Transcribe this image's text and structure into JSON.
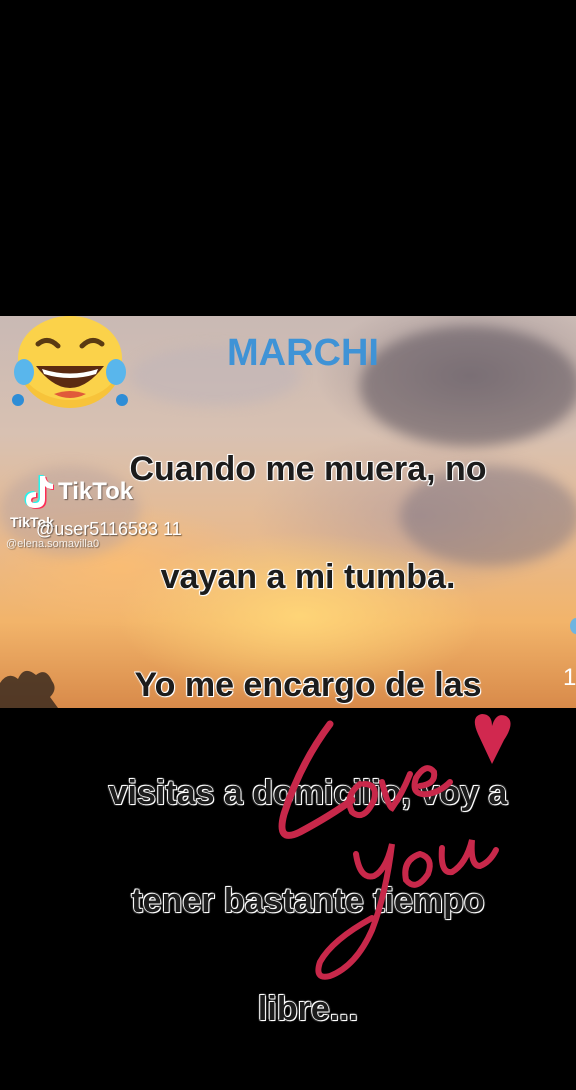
{
  "overlay": {
    "title": "MARCHI",
    "quote_lines": [
      "Cuando me muera, no",
      "vayan a mi tumba.",
      "Yo me encargo de las",
      "visitas a domicilio, voy a",
      "tener bastante tiempo",
      "libre..."
    ],
    "emoji_name": "tears-of-joy-emoji"
  },
  "watermark": {
    "logo_text": "TikTok",
    "small_logo_text": "TikTok",
    "handle": "@user5116583 11",
    "secondary_handle": "@elena.somavilla0"
  },
  "edge_text": "1",
  "decoration": {
    "handwriting": "Love you",
    "heart_color": "#d1284f",
    "title_color": "#3f93d6"
  }
}
